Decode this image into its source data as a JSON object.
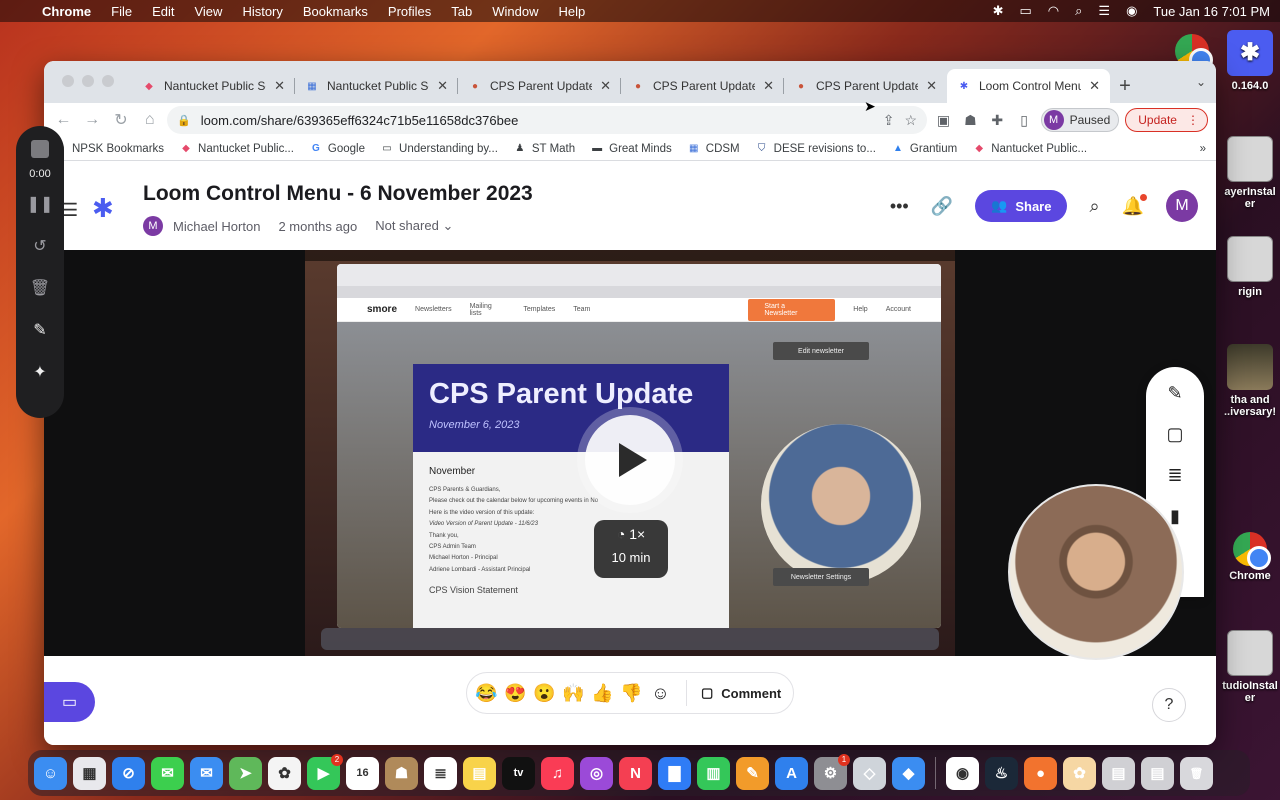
{
  "menubar": {
    "app": "Chrome",
    "items": [
      "File",
      "Edit",
      "View",
      "History",
      "Bookmarks",
      "Profiles",
      "Tab",
      "Window",
      "Help"
    ],
    "clock": "Tue Jan 16  7:01 PM"
  },
  "desktop": {
    "icons": [
      {
        "label": "",
        "kind": "chrome"
      },
      {
        "label": "0.164.0",
        "kind": "loom"
      },
      {
        "label": "ayerInstal\ner",
        "kind": "file"
      },
      {
        "label": "rigin",
        "kind": "file"
      },
      {
        "label": "tha and\n..iversary!",
        "kind": "photo"
      },
      {
        "label": "Chrome",
        "kind": "chrome"
      },
      {
        "label": "tudioInstal\ner",
        "kind": "file"
      },
      {
        "label": "",
        "kind": "file"
      }
    ]
  },
  "tabs": [
    {
      "title": "Nantucket Public Sc",
      "fav_color": "#e54a6b",
      "fav": "◆"
    },
    {
      "title": "Nantucket Public Sc",
      "fav_color": "#3b6fd8",
      "fav": "▦"
    },
    {
      "title": "CPS Parent Update",
      "fav_color": "#c9543a",
      "fav": "●"
    },
    {
      "title": "CPS Parent Update",
      "fav_color": "#c9543a",
      "fav": "●"
    },
    {
      "title": "CPS Parent Update",
      "fav_color": "#c9543a",
      "fav": "●"
    },
    {
      "title": "Loom Control Menu",
      "fav_color": "#4b5cf0",
      "fav": "✱",
      "active": true
    }
  ],
  "toolbar": {
    "url": "loom.com/share/639365eff6324c71b5e11658dc376bee",
    "profile_letter": "M",
    "profile_label": "Paused",
    "update_label": "Update"
  },
  "bookmarks": [
    {
      "label": "NPSK Bookmarks",
      "icon": "▭"
    },
    {
      "label": "Nantucket Public...",
      "icon": "◆"
    },
    {
      "label": "Google",
      "icon": "G"
    },
    {
      "label": "Understanding by...",
      "icon": "▭"
    },
    {
      "label": "ST Math",
      "icon": "♟"
    },
    {
      "label": "Great Minds",
      "icon": "▬"
    },
    {
      "label": "CDSM",
      "icon": "▦"
    },
    {
      "label": "DESE revisions to...",
      "icon": "⛉"
    },
    {
      "label": "Grantium",
      "icon": "▲"
    },
    {
      "label": "Nantucket Public...",
      "icon": "◆"
    }
  ],
  "video": {
    "title": "Loom Control Menu - 6 November 2023",
    "author_initial": "M",
    "author": "Michael Horton",
    "age": "2 months ago",
    "sharing": "Not shared",
    "share_label": "Share",
    "avatar_letter": "M",
    "speed": "1×",
    "duration": "10 min"
  },
  "inner_screen": {
    "smore_logo": "smore",
    "nav": [
      "Newsletters",
      "Mailing lists",
      "Templates",
      "Team"
    ],
    "cta": "Start a Newsletter",
    "help": "Help",
    "account": "Account",
    "newsletter_title": "CPS Parent Update",
    "newsletter_date": "November 6, 2023",
    "month": "November",
    "lines": [
      "CPS Parents & Guardians,",
      "Please check out the calendar below for upcoming events in No",
      "Here is the video version of this update:",
      "Video Version of Parent Update - 11/6/23",
      "Thank you,",
      "CPS Admin Team",
      "Michael Horton - Principal",
      "Adriene Lombardi - Assistant Principal"
    ],
    "footer_heading": "CPS Vision Statement",
    "edit_btn": "Edit newsletter",
    "settings_btn": "Newsletter Settings"
  },
  "recorder": {
    "time": "0:00"
  },
  "reactions": [
    "😂",
    "😍",
    "😮",
    "🙌",
    "👍",
    "👎",
    "☺"
  ],
  "comment_label": "Comment",
  "help_label": "?",
  "dock": [
    {
      "name": "finder",
      "bg": "#3b8df1",
      "glyph": "☺"
    },
    {
      "name": "launchpad",
      "bg": "#e8e8ec",
      "glyph": "▦"
    },
    {
      "name": "safari",
      "bg": "#2f80ed",
      "glyph": "⊘"
    },
    {
      "name": "messages",
      "bg": "#3ccf4e",
      "glyph": "✉"
    },
    {
      "name": "mail",
      "bg": "#3b8df1",
      "glyph": "✉"
    },
    {
      "name": "maps",
      "bg": "#5fb85a",
      "glyph": "➤"
    },
    {
      "name": "photos",
      "bg": "#f4f4f4",
      "glyph": "✿"
    },
    {
      "name": "facetime",
      "bg": "#34c759",
      "glyph": "▶",
      "badge": "2"
    },
    {
      "name": "calendar",
      "bg": "#ffffff",
      "glyph": "16"
    },
    {
      "name": "contacts",
      "bg": "#b08a5a",
      "glyph": "☗"
    },
    {
      "name": "reminders",
      "bg": "#ffffff",
      "glyph": "≣"
    },
    {
      "name": "notes",
      "bg": "#f8d34a",
      "glyph": "▤"
    },
    {
      "name": "tv",
      "bg": "#111111",
      "glyph": "tv"
    },
    {
      "name": "music",
      "bg": "#fa3c55",
      "glyph": "♫"
    },
    {
      "name": "podcasts",
      "bg": "#9b4ad8",
      "glyph": "◎"
    },
    {
      "name": "news",
      "bg": "#f43f52",
      "glyph": "N"
    },
    {
      "name": "keynote",
      "bg": "#2f7cf6",
      "glyph": "▇"
    },
    {
      "name": "numbers",
      "bg": "#34c759",
      "glyph": "▥"
    },
    {
      "name": "pages",
      "bg": "#f29b2a",
      "glyph": "✎"
    },
    {
      "name": "app-store",
      "bg": "#2f80ed",
      "glyph": "A"
    },
    {
      "name": "system-settings",
      "bg": "#8e8e93",
      "glyph": "⚙",
      "badge": "1"
    },
    {
      "name": "preview",
      "bg": "#cfd4da",
      "glyph": "◇"
    },
    {
      "name": "roblox",
      "bg": "#3b8df1",
      "glyph": "◆"
    },
    {
      "name": "chrome",
      "bg": "#ffffff",
      "glyph": "◉"
    },
    {
      "name": "steam",
      "bg": "#1b2838",
      "glyph": "♨"
    },
    {
      "name": "firefox",
      "bg": "#f2732e",
      "glyph": "●"
    },
    {
      "name": "stickies",
      "bg": "#f6d7a4",
      "glyph": "✿"
    },
    {
      "name": "downloads",
      "bg": "#d0d0d4",
      "glyph": "▤"
    },
    {
      "name": "documents",
      "bg": "#d0d0d4",
      "glyph": "▤"
    },
    {
      "name": "trash",
      "bg": "#d8d8dc",
      "glyph": "🗑"
    }
  ]
}
